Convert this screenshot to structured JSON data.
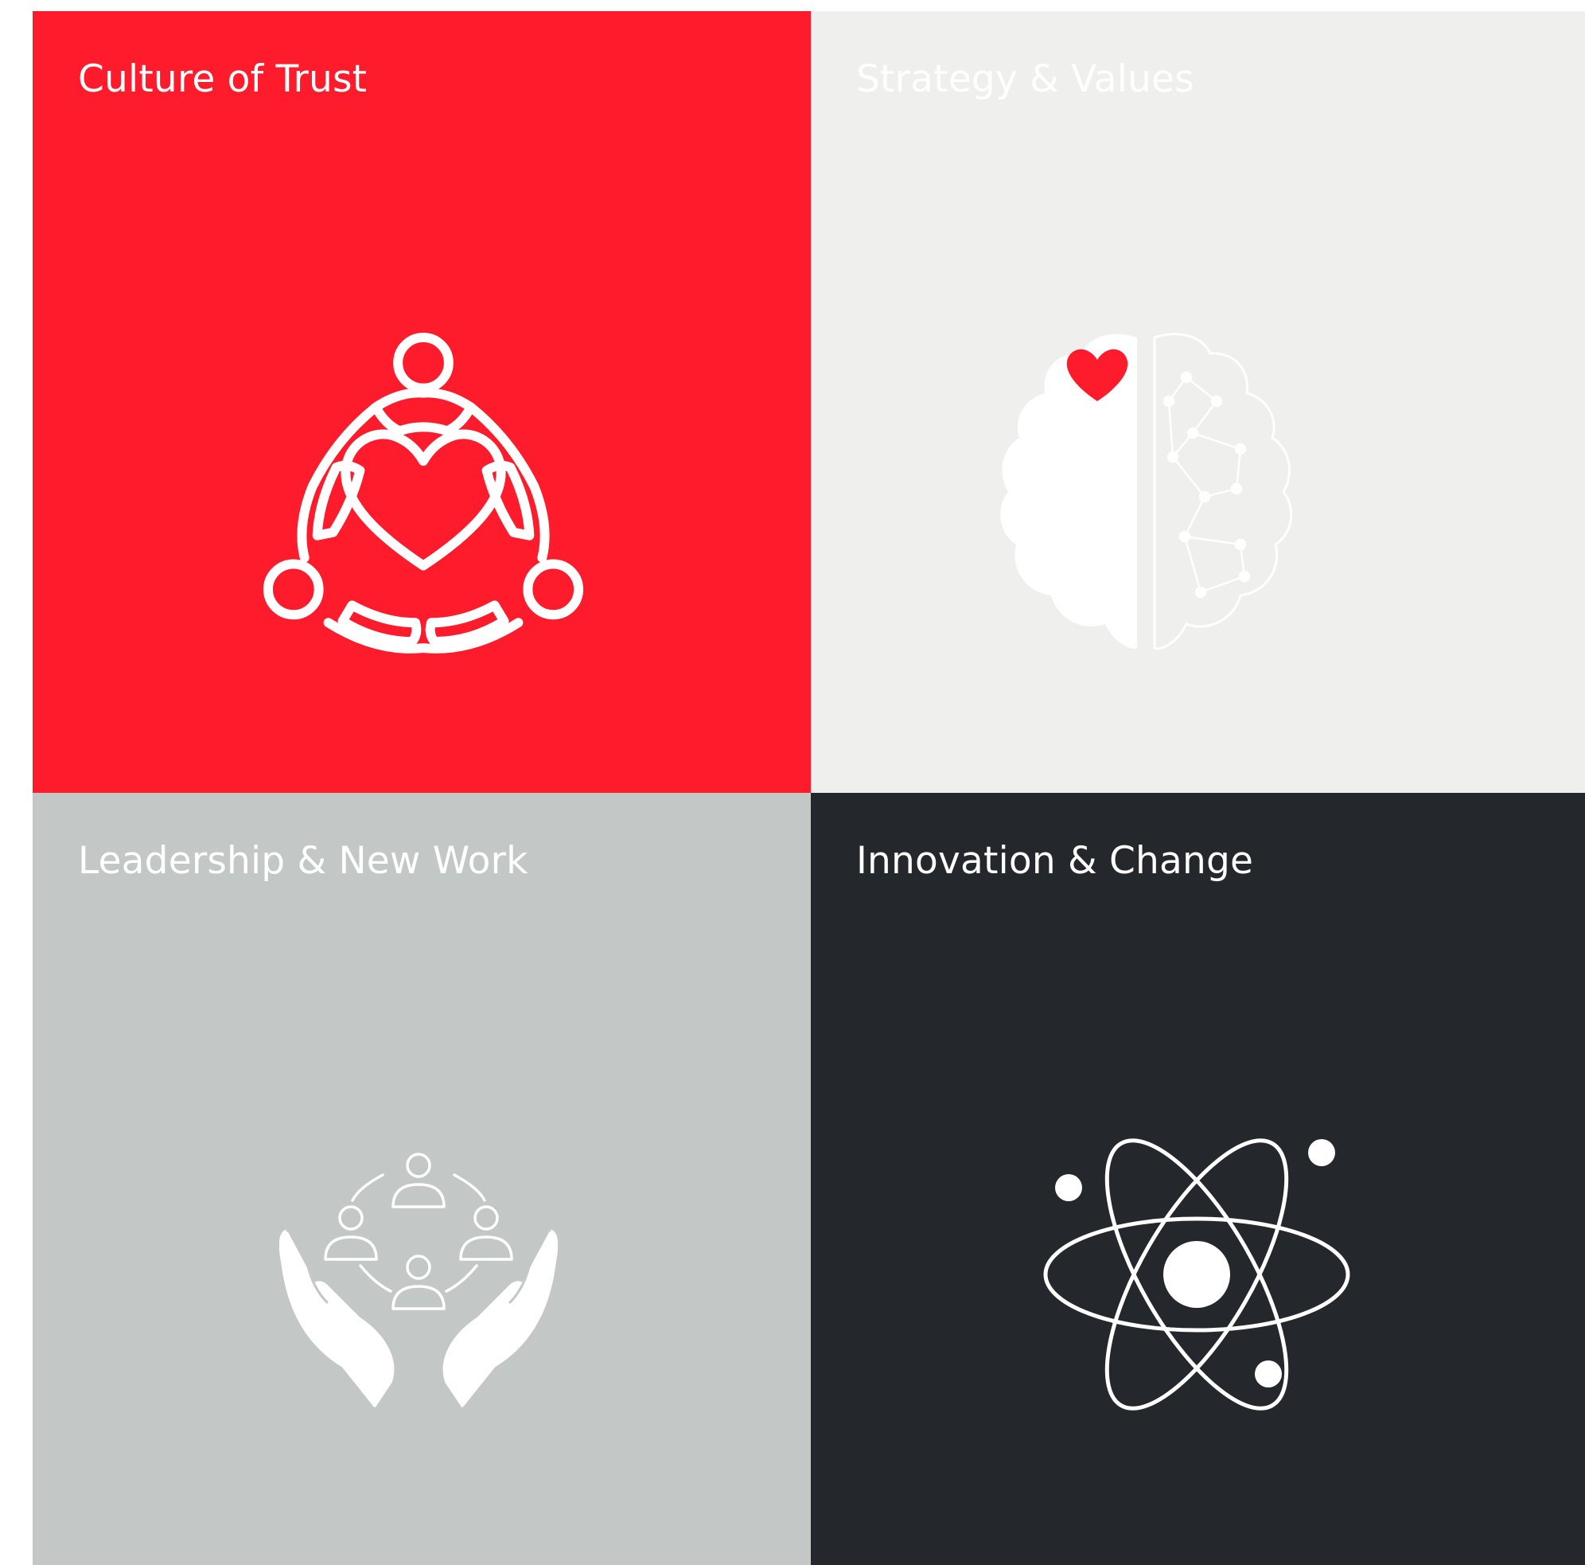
{
  "tiles": [
    {
      "id": "trust",
      "title": "Culture of Trust",
      "background": "#fe1b2c",
      "title_color": "#ffffff",
      "icon": "people-circle-heart-icon"
    },
    {
      "id": "strategy",
      "title": "Strategy & Values",
      "background": "#efefed",
      "title_color": "#ffffff",
      "icon": "brain-heart-icon"
    },
    {
      "id": "leadership",
      "title": "Leadership & New Work",
      "background": "#c3c7c6",
      "title_color": "#ffffff",
      "icon": "hands-holding-team-icon"
    },
    {
      "id": "innovation",
      "title": "Innovation & Change",
      "background": "#24272c",
      "title_color": "#ffffff",
      "icon": "atom-icon"
    }
  ]
}
